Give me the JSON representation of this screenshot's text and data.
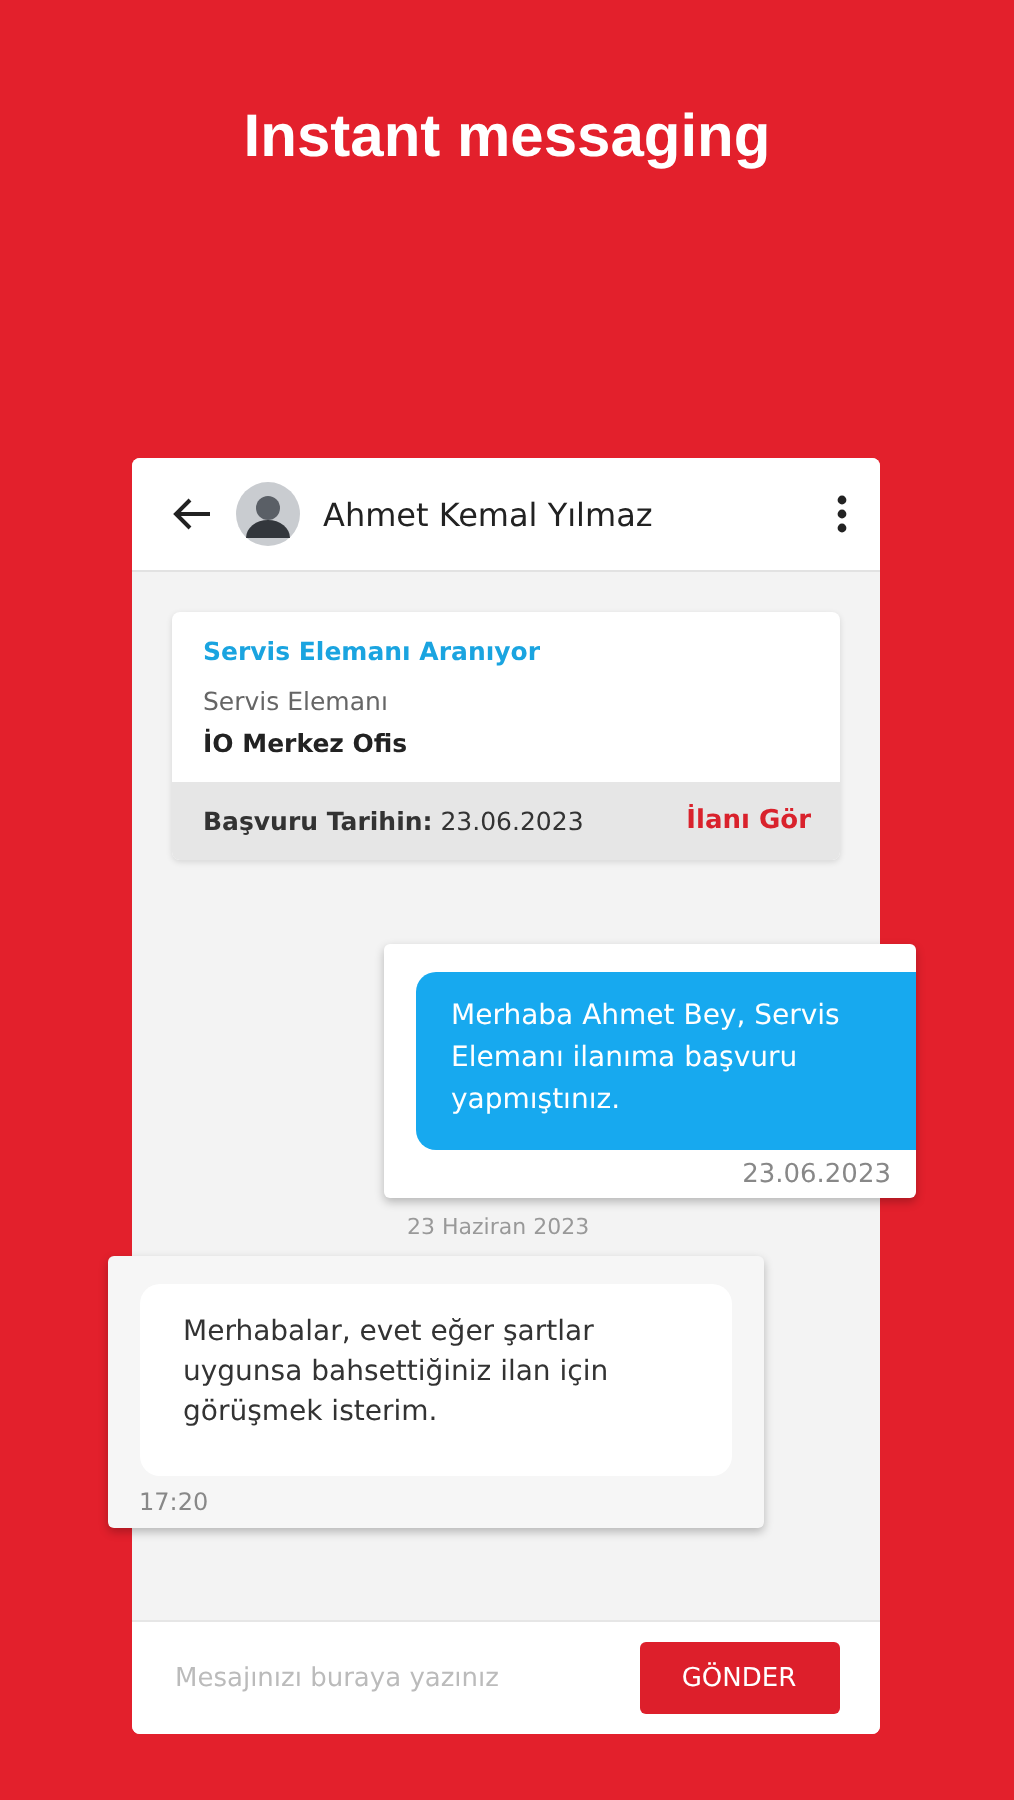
{
  "headline": "Instant messaging",
  "chat": {
    "contact_name": "Ahmet Kemal Yılmaz",
    "job_card": {
      "title": "Servis Elemanı Aranıyor",
      "position": "Servis Elemanı",
      "company": "İO Merkez Ofis",
      "date_label": "Başvuru Tarihin:",
      "date": "23.06.2023",
      "link": "İlanı Gör"
    },
    "messages": [
      {
        "kind": "sent",
        "text": "Merhaba Ahmet Bey, Servis Elemanı ilanıma başvuru yapmıştınız.",
        "time": "23.06.2023",
        "day_label": "23 Haziran 2023"
      },
      {
        "kind": "received",
        "text": "Merhabalar, evet eğer şartlar uygunsa bahsettiğiniz ilan için görüşmek isterim.",
        "time": "17:20"
      }
    ],
    "composer": {
      "placeholder": "Mesajınızı buraya yazınız",
      "send_button": "GÖNDER"
    }
  }
}
